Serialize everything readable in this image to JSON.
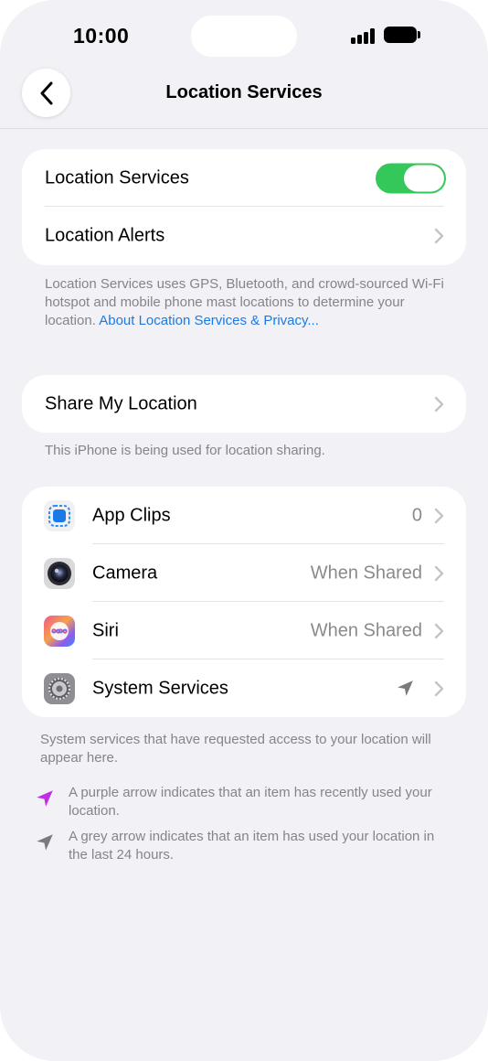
{
  "status_bar": {
    "time": "10:00"
  },
  "nav": {
    "title": "Location Services"
  },
  "location_card": {
    "location_services_label": "Location Services",
    "location_services_on": true,
    "location_alerts_label": "Location Alerts"
  },
  "location_footnote": {
    "text": "Location Services uses GPS, Bluetooth, and crowd-sourced Wi-Fi hotspot and mobile phone mast locations to determine your location. ",
    "link": "About Location Services & Privacy..."
  },
  "share_card": {
    "label": "Share My Location"
  },
  "share_footnote": "This iPhone is being used for location sharing.",
  "apps": [
    {
      "label": "App Clips",
      "value": "0",
      "icon": "app-clips-icon"
    },
    {
      "label": "Camera",
      "value": "When Shared",
      "icon": "camera-app-icon"
    },
    {
      "label": "Siri",
      "value": "When Shared",
      "icon": "siri-app-icon"
    },
    {
      "label": "System Services",
      "value": "",
      "icon": "settings-gear-app-icon",
      "status_icon": "location-arrow-grey-icon"
    }
  ],
  "system_footnote": "System services that have requested access to your location will appear here.",
  "legend": [
    {
      "icon": "location-arrow-purple-icon",
      "color": "#c02ee6",
      "text": "A purple arrow indicates that an item has recently used your location."
    },
    {
      "icon": "location-arrow-grey-icon",
      "color": "#7a7a7e",
      "text": "A grey arrow indicates that an item has used your location in the last 24 hours."
    }
  ],
  "colors": {
    "accent": "#1a7ae6",
    "toggle_on": "#34c759",
    "background": "#f2f1f6"
  }
}
